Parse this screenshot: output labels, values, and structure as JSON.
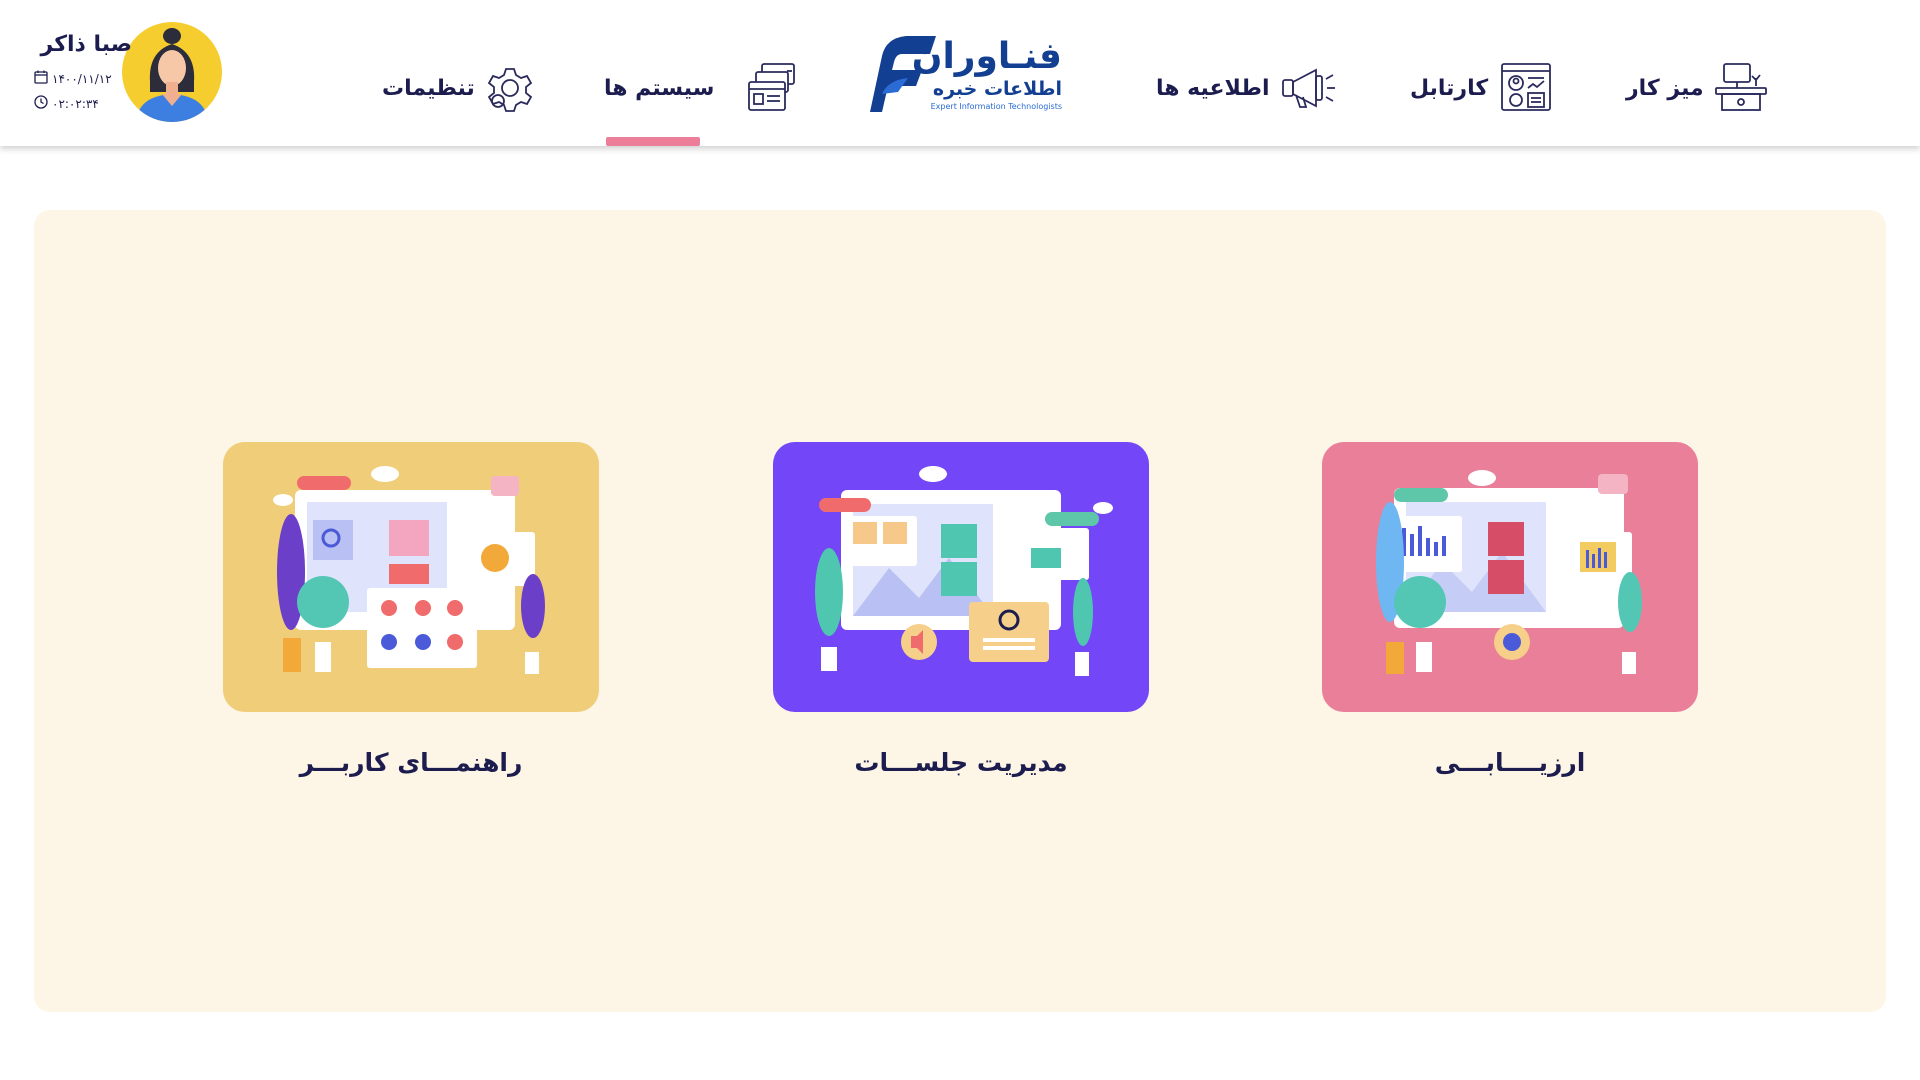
{
  "nav": {
    "desk_label": "میز کار",
    "cartable_label": "کارتابل",
    "announcements_label": "اطلاعیه ها",
    "systems_label": "سیستم ها",
    "settings_label": "تنظیمات"
  },
  "logo": {
    "title": "فنـاوران",
    "subtitle": "اطلاعات خبره",
    "english": "Expert Information Technologists"
  },
  "user": {
    "name": "صبا ذاکر",
    "date": "۱۴۰۰/۱۱/۱۲",
    "time": "۰۲:۰۲:۳۴"
  },
  "cards": [
    {
      "label": "ارزیــــابـــی",
      "color": "#ea7f99"
    },
    {
      "label": "مدیریت جلســـات",
      "color": "#7347f7"
    },
    {
      "label": "راهنمـــای کاربـــر",
      "color": "#f0cd78"
    }
  ],
  "colors": {
    "accent_underline": "#ec7e99",
    "main_background": "#fdf6e6",
    "text": "#1c1d4e",
    "logo_blue": "#123f91"
  },
  "icons": {
    "desk": "desk-computer-icon",
    "cartable": "dashboard-document-icon",
    "announcements": "megaphone-icon",
    "systems": "stacked-windows-icon",
    "settings": "gear-icon",
    "date": "calendar-icon",
    "time": "clock-icon"
  }
}
